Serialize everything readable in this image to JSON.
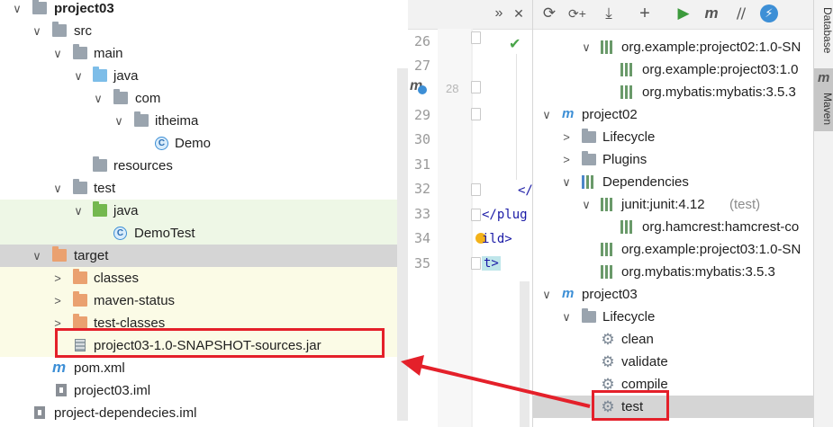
{
  "project_tree": [
    {
      "label": "project03",
      "bold": true,
      "arrow": "∨"
    },
    {
      "label": "src",
      "arrow": "∨"
    },
    {
      "label": "main",
      "arrow": "∨"
    },
    {
      "label": "java",
      "arrow": "∨"
    },
    {
      "label": "com",
      "arrow": "∨"
    },
    {
      "label": "itheima",
      "arrow": "∨"
    },
    {
      "label": "Demo"
    },
    {
      "label": "resources"
    },
    {
      "label": "test",
      "arrow": "∨"
    },
    {
      "label": "java",
      "arrow": "∨"
    },
    {
      "label": "DemoTest"
    },
    {
      "label": "target",
      "arrow": "∨"
    },
    {
      "label": "classes",
      "arrow": ">"
    },
    {
      "label": "maven-status",
      "arrow": ">"
    },
    {
      "label": "test-classes",
      "arrow": ">"
    },
    {
      "label": "project03-1.0-SNAPSHOT-sources.jar"
    },
    {
      "label": "pom.xml"
    },
    {
      "label": "project03.iml"
    },
    {
      "label": "project-dependecies.iml"
    }
  ],
  "editor": {
    "line_numbers": [
      "26",
      "27",
      "28",
      "29",
      "30",
      "31",
      "32",
      "33",
      "34",
      "35"
    ],
    "code_fragments": [
      "</",
      "</plug",
      "ild>",
      "t>"
    ],
    "toolbar_icons": [
      "»",
      "✕"
    ]
  },
  "maven": {
    "toolbar_icons": [
      "⟳",
      "⟳+",
      "⤓",
      "+",
      "▶",
      "m",
      "⧸⧸",
      "⚡"
    ],
    "tree": [
      {
        "label": "org.example:project02:1.0-SN",
        "arrow": "∨"
      },
      {
        "label": "org.example:project03:1.0"
      },
      {
        "label": "org.mybatis:mybatis:3.5.3"
      },
      {
        "label": "project02",
        "arrow": "∨"
      },
      {
        "label": "Lifecycle",
        "arrow": ">"
      },
      {
        "label": "Plugins",
        "arrow": ">"
      },
      {
        "label": "Dependencies",
        "arrow": "∨"
      },
      {
        "label": "junit:junit:4.12",
        "scope": "(test)",
        "arrow": "∨"
      },
      {
        "label": "org.hamcrest:hamcrest-co"
      },
      {
        "label": "org.example:project03:1.0-SN"
      },
      {
        "label": "org.mybatis:mybatis:3.5.3"
      },
      {
        "label": "project03",
        "arrow": "∨"
      },
      {
        "label": "Lifecycle",
        "arrow": "∨"
      },
      {
        "label": "clean"
      },
      {
        "label": "validate"
      },
      {
        "label": "compile"
      },
      {
        "label": "test"
      }
    ]
  },
  "side_tabs": {
    "database": "Database",
    "maven": "Maven",
    "maven_icon": "m"
  },
  "colors": {
    "highlight_red": "#e4202a",
    "test_band": "#eef7e6",
    "target_band": "#fbfbe6",
    "selected_row": "#d5d5d5"
  }
}
